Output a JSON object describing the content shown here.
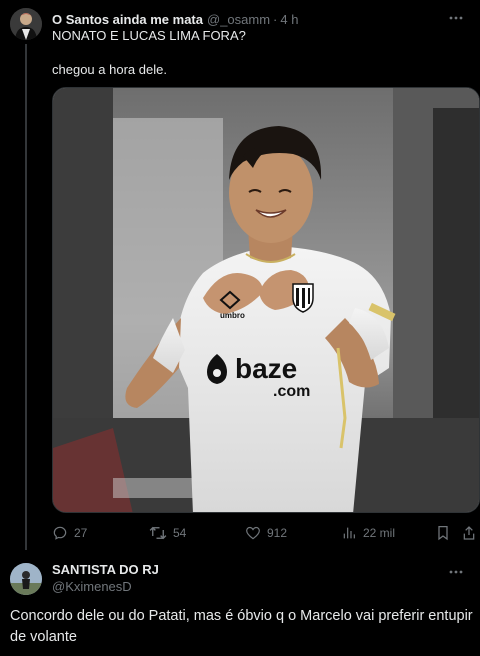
{
  "tweet": {
    "author_name": "O Santos ainda me mata",
    "author_handle": "@_osamm",
    "separator": "·",
    "time": "4 h",
    "line1": "NONATO E LUCAS LIMA FORA?",
    "line2": "chegou a hora dele.",
    "image_text": {
      "sponsor_brand": "baze",
      "sponsor_domain": ".com",
      "kit_brand": "umbro"
    },
    "stats": {
      "replies": "27",
      "retweets": "54",
      "likes": "912",
      "views": "22 mil"
    }
  },
  "reply": {
    "author_name": "SANTISTA DO RJ",
    "author_handle": "@KximenesD",
    "text": "Concordo dele ou do Patati, mas é óbvio q o Marcelo vai preferir entupir de volante"
  },
  "colors": {
    "background": "#000000",
    "text_primary": "#e7e9ea",
    "text_secondary": "#71767b",
    "border": "#2f3336"
  },
  "icons": [
    "ellipsis-icon",
    "reply-icon",
    "retweet-icon",
    "like-icon",
    "views-icon",
    "bookmark-icon",
    "share-icon"
  ]
}
